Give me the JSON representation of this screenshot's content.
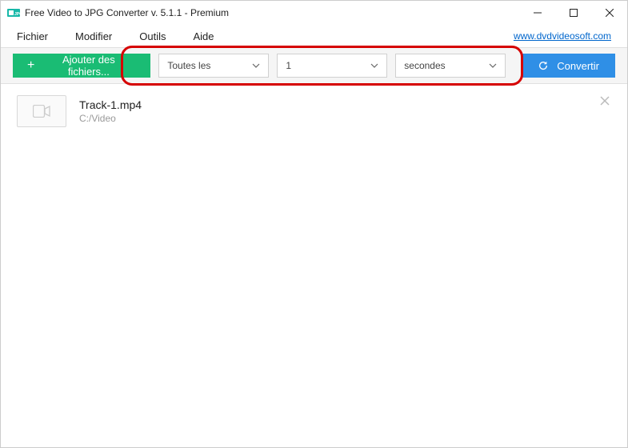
{
  "title": "Free Video to JPG Converter v. 5.1.1 - Premium",
  "menu": {
    "file": "Fichier",
    "edit": "Modifier",
    "tools": "Outils",
    "help": "Aide"
  },
  "promo_link": "www.dvdvideosoft.com",
  "toolbar": {
    "add_label": "Ajouter des fichiers...",
    "convert_label": "Convertir",
    "dd_mode": "Toutes les",
    "dd_count": "1",
    "dd_unit": "secondes"
  },
  "file": {
    "name": "Track-1.mp4",
    "path": "C:/Video"
  }
}
